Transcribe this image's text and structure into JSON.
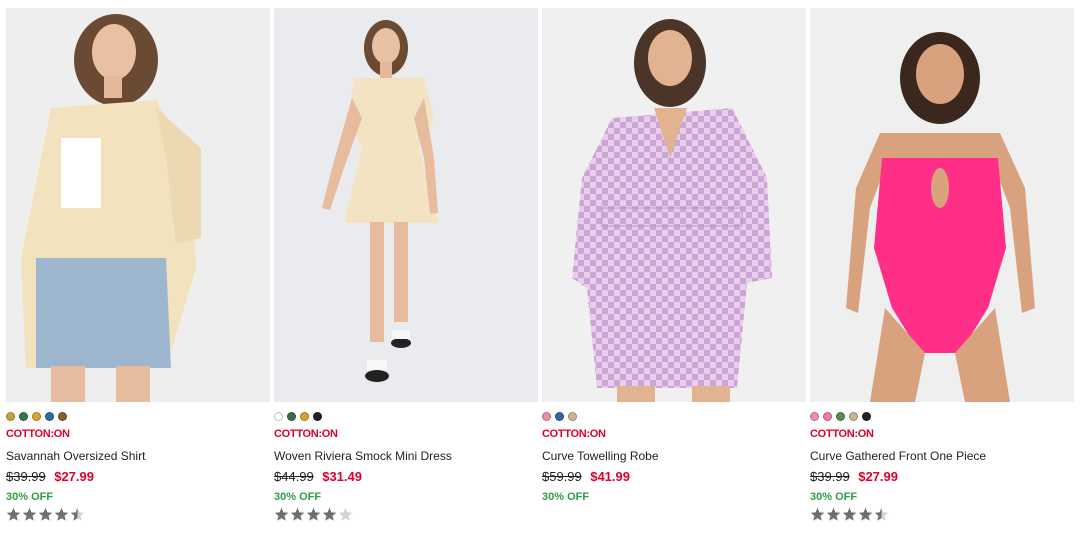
{
  "products": [
    {
      "swatches": [
        "#c9a33a",
        "#2e7d4a",
        "#d9a52b",
        "#2f6aa3",
        "#8b5a2b"
      ],
      "brand": "COTTON:ON",
      "name": "Savannah Oversized Shirt",
      "was_price": "$39.99",
      "now_price": "$27.99",
      "discount": "30% OFF",
      "rating": 4.5
    },
    {
      "swatches": [
        "#ffffff",
        "#3d6b43",
        "#d8a22d",
        "#222222"
      ],
      "brand": "COTTON:ON",
      "name": "Woven Riviera Smock Mini Dress",
      "was_price": "$44.99",
      "now_price": "$31.49",
      "discount": "30% OFF",
      "rating": 4
    },
    {
      "swatches": [
        "#e78fae",
        "#2f6aa3",
        "#c8b59a"
      ],
      "brand": "COTTON:ON",
      "name": "Curve Towelling Robe",
      "was_price": "$59.99",
      "now_price": "$41.99",
      "discount": "30% OFF",
      "rating": 0
    },
    {
      "swatches": [
        "#ee8eb0",
        "#e77fa5",
        "#5b8a5a",
        "#c8b59a",
        "#222222"
      ],
      "brand": "COTTON:ON",
      "name": "Curve Gathered Front One Piece",
      "was_price": "$39.99",
      "now_price": "$27.99",
      "discount": "30% OFF",
      "rating": 4.5
    }
  ],
  "colors": {
    "brand_red": "#e0002a",
    "discount_green": "#2e9e43",
    "star_filled": "#6e6e6e",
    "star_empty": "#d3d3d3"
  }
}
